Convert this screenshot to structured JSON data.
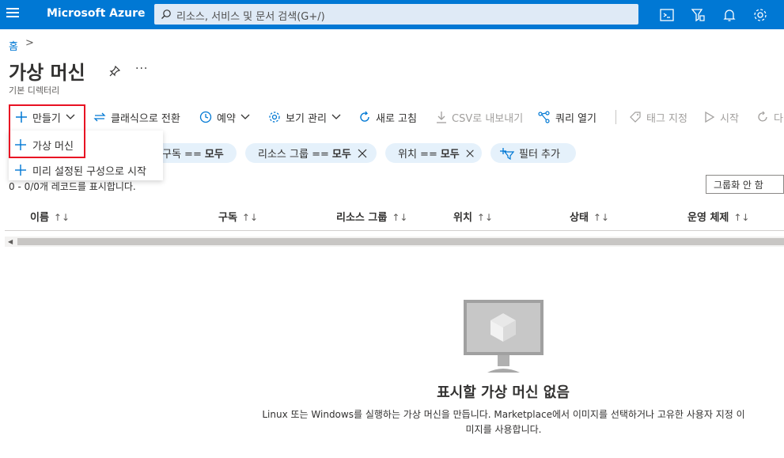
{
  "topbar": {
    "brand": "Microsoft Azure",
    "search_placeholder": "리소스, 서비스 및 문서 검색(G+/)",
    "accent": "#0078d4",
    "icons": [
      "cloud-shell-icon",
      "directory-filter-icon",
      "notifications-icon",
      "settings-icon"
    ]
  },
  "breadcrumb": {
    "home": "홈"
  },
  "page": {
    "title": "가상 머신",
    "subtitle": "기본 디렉터리"
  },
  "toolbar": {
    "create": "만들기",
    "classic": "클래식으로 전환",
    "schedule": "예약",
    "manage_view": "보기 관리",
    "refresh": "새로 고침",
    "export_csv": "CSV로 내보내기",
    "query": "쿼리 열기",
    "tags": "태그 지정",
    "start": "시작",
    "restart_partial": "다"
  },
  "create_menu": {
    "items": [
      "가상 머신",
      "미리 설정된 구성으로 시작"
    ]
  },
  "filters": {
    "subscription": {
      "label": "구독 ==",
      "value": "모두"
    },
    "resource_group": {
      "label": "리소스 그룹 ==",
      "value": "모두"
    },
    "location": {
      "label": "위치 ==",
      "value": "모두"
    },
    "add_filter": "필터 추가"
  },
  "records": "0 - 0/0개 레코드를 표시합니다.",
  "group_by": "그룹화 안 함",
  "table": {
    "columns": [
      "이름",
      "구독",
      "리소스 그룹",
      "위치",
      "상태",
      "운영 체제"
    ]
  },
  "empty_state": {
    "title": "표시할 가상 머신 없음",
    "description_line1": "Linux 또는 Windows를 실행하는 가상 머신을 만듭니다. Marketplace에서 이미지를 선택하거나 고유한 사용자 지정 이",
    "description_line2": "미지를 사용합니다."
  }
}
